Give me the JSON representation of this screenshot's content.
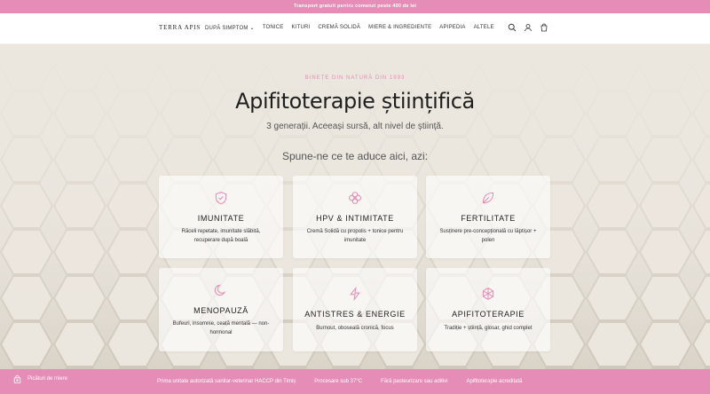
{
  "announcement": "Transport gratuit pentru comenzi peste 400 de lei",
  "logo": {
    "name": "TERRA APIS",
    "tagline": ""
  },
  "nav": [
    {
      "label": "DUPĂ SIMPTOM"
    },
    {
      "label": "TONICE"
    },
    {
      "label": "KITURI"
    },
    {
      "label": "CREMĂ SOLIDĂ"
    },
    {
      "label": "MIERE & INGREDIENTE"
    },
    {
      "label": "APIPEDIA"
    },
    {
      "label": "ALTELE"
    }
  ],
  "hero": {
    "eyebrow": "BINEȚE DIN NATURĂ DIN 1993",
    "title": "Apifitoterapie științifică",
    "subtitle": "3 generații. Aceeași sursă, alt nivel de știință.",
    "question": "Spune-ne ce te aduce aici, azi:"
  },
  "cards": [
    {
      "title": "IMUNITATE",
      "desc": "Răceli repetate, imunitate slăbită, recuperare după boală",
      "icon": "shield-icon"
    },
    {
      "title": "HPV & INTIMITATE",
      "desc": "Cremă Solidă cu propolis + tonice pentru imunitate",
      "icon": "flower-icon"
    },
    {
      "title": "FERTILITATE",
      "desc": "Susținere pre-concepțională cu lăptișor + polen",
      "icon": "leaf-icon"
    },
    {
      "title": "MENOPAUZĂ",
      "desc": "Bufeuri, insomnie, ceață mentală — non-hormonal",
      "icon": "moon-icon"
    },
    {
      "title": "ANTISTRES & ENERGIE",
      "desc": "Burnout, oboseală cronică, focus",
      "icon": "lightning-icon"
    },
    {
      "title": "APIFITOTERAPIE",
      "desc": "Tradiție + știință, glosar, ghid complet",
      "icon": "hexagon-icon"
    }
  ],
  "rewards": {
    "label": "Picături de miere"
  },
  "trust_bar": [
    "Prima unitate autorizată sanitar-veterinar HACCP din Timiș",
    "Procesare sub 37°C",
    "Fără pasteurizare sau aditivi",
    "Apifitoterapie acreditată"
  ],
  "colors": {
    "accent": "#e58db6",
    "text": "#222222"
  }
}
